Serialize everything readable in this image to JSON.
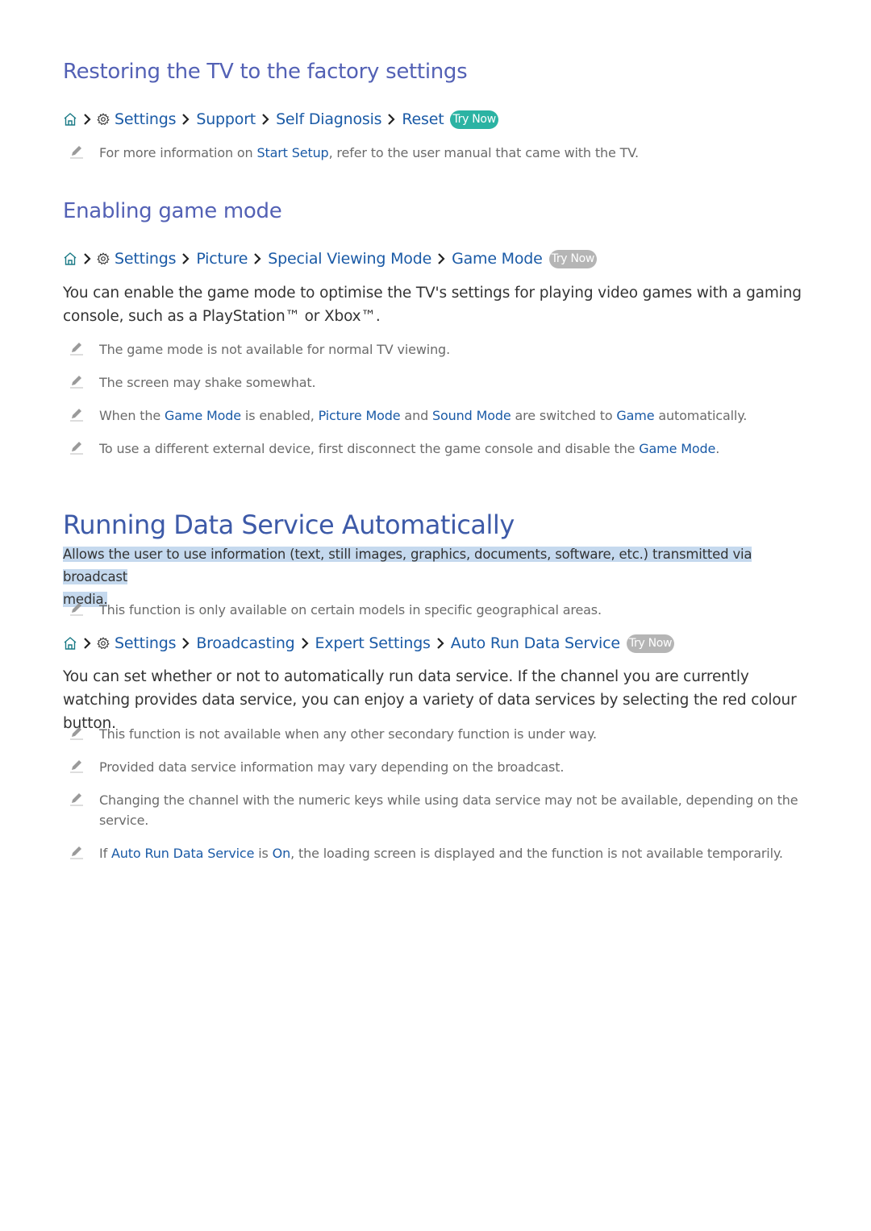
{
  "sections": {
    "restore": {
      "title": "Restoring the TV to the factory settings",
      "path": {
        "home_icon": "home-icon",
        "gear_icon": "gear-icon",
        "items": [
          "Settings",
          "Support",
          "Self Diagnosis",
          "Reset"
        ],
        "try_now": "Try Now",
        "try_now_color": "#2bb3a3"
      },
      "notes": [
        {
          "pre": "For more information on ",
          "link": "Start Setup",
          "post": ", refer to the user manual that came with the TV."
        }
      ]
    },
    "game_mode": {
      "title": "Enabling game mode",
      "path": {
        "items": [
          "Settings",
          "Picture",
          "Special Viewing Mode",
          "Game Mode"
        ],
        "try_now": "Try Now",
        "try_now_color": "#b5b5b5"
      },
      "body": "You can enable the game mode to optimise the TV's settings for playing video games with a gaming console, such as a PlayStation™ or Xbox™.",
      "notes": [
        {
          "text": "The game mode is not available for normal TV viewing."
        },
        {
          "text": "The screen may shake somewhat."
        },
        {
          "p1": "When the ",
          "l1": "Game Mode",
          "p2": " is enabled, ",
          "l2": "Picture Mode",
          "p3": " and ",
          "l3": "Sound Mode",
          "p4": " are switched to ",
          "l4": "Game",
          "p5": " automatically."
        },
        {
          "p1": "To use a different external device, first disconnect the game console and disable the ",
          "l1": "Game Mode",
          "p2": "."
        }
      ]
    },
    "data_service": {
      "title": "Running Data Service Automatically",
      "highlighted_text_line1": "Allows the user to use information (text, still images, graphics, documents, software, etc.) transmitted via broadcast",
      "highlighted_text_line2": "media.",
      "pre_note": "This function is only available on certain models in specific geographical areas.",
      "path": {
        "items": [
          "Settings",
          "Broadcasting",
          "Expert Settings",
          "Auto Run Data Service"
        ],
        "try_now": "Try Now",
        "try_now_color": "#b5b5b5"
      },
      "body": "You can set whether or not to automatically run data service. If the channel you are currently watching provides data service, you can enjoy a variety of data services by selecting the red colour button.",
      "notes": [
        {
          "text": "This function is not available when any other secondary function is under way."
        },
        {
          "text": "Provided data service information may vary depending on the broadcast."
        },
        {
          "text": "Changing the channel with the numeric keys while using data service may not be available, depending on the service."
        },
        {
          "p1": "If ",
          "l1": "Auto Run Data Service",
          "p2": " is ",
          "l2": "On",
          "p3": ", the loading screen is displayed and the function is not available temporarily."
        }
      ]
    }
  },
  "colors": {
    "heading": "#5361b5",
    "main_heading": "#3d5aa8",
    "link": "#1a5aa6",
    "highlight": "#c5d9ee"
  }
}
